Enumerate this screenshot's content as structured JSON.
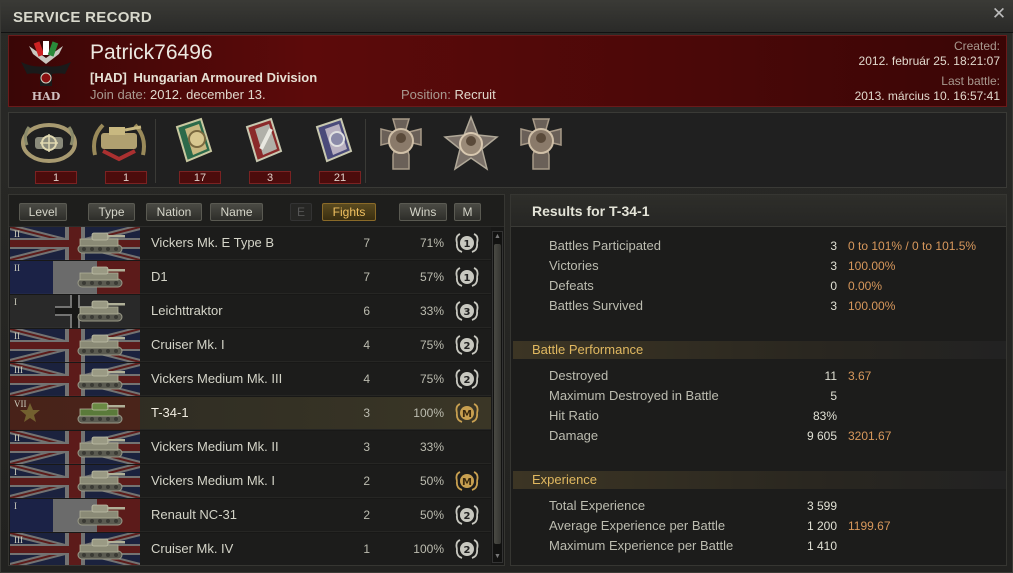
{
  "window": {
    "title": "SERVICE RECORD",
    "close_symbol": "✕"
  },
  "player": {
    "name": "Patrick76496",
    "clan_tag": "[HAD]",
    "clan_name": "Hungarian Armoured Division",
    "join_label": "Join date:",
    "join_date": "2012. december 13.",
    "position_label": "Position:",
    "position": "Recruit",
    "created_label": "Created:",
    "created": "2012. február 25. 18:21:07",
    "last_battle_label": "Last battle:",
    "last_battle": "2013. március 10. 16:57:41"
  },
  "medals": [
    {
      "icon": "sniper-tank-badge-icon",
      "count": "1"
    },
    {
      "icon": "tank-expert-badge-icon",
      "count": "1"
    },
    {
      "icon": "green-ribbon-medal-icon",
      "count": "17"
    },
    {
      "icon": "red-ribbon-medal-icon",
      "count": "3"
    },
    {
      "icon": "blue-ribbon-medal-icon",
      "count": "21"
    },
    {
      "icon": "cross-medal-1-icon",
      "count": ""
    },
    {
      "icon": "star-medal-icon",
      "count": ""
    },
    {
      "icon": "cross-medal-2-icon",
      "count": ""
    }
  ],
  "sort_buttons": {
    "level": "Level",
    "type": "Type",
    "nation": "Nation",
    "name": "Name",
    "e": "E",
    "fights": "Fights",
    "wins": "Wins",
    "m": "M"
  },
  "tanks": [
    {
      "tier": "II",
      "nation": "uk",
      "name": "Vickers Mk. E Type B",
      "fights": "7",
      "wins": "71%",
      "mastery": "1",
      "selected": false
    },
    {
      "tier": "II",
      "nation": "france",
      "name": "D1",
      "fights": "7",
      "wins": "57%",
      "mastery": "1",
      "selected": false
    },
    {
      "tier": "I",
      "nation": "germany",
      "name": "Leichttraktor",
      "fights": "6",
      "wins": "33%",
      "mastery": "3",
      "selected": false
    },
    {
      "tier": "II",
      "nation": "uk",
      "name": "Cruiser Mk. I",
      "fights": "4",
      "wins": "75%",
      "mastery": "2",
      "selected": false
    },
    {
      "tier": "III",
      "nation": "uk",
      "name": "Vickers Medium Mk. III",
      "fights": "4",
      "wins": "75%",
      "mastery": "2",
      "selected": false
    },
    {
      "tier": "VII",
      "nation": "ussr",
      "name": "T-34-1",
      "fights": "3",
      "wins": "100%",
      "mastery": "M",
      "selected": true
    },
    {
      "tier": "II",
      "nation": "uk",
      "name": "Vickers Medium Mk. II",
      "fights": "3",
      "wins": "33%",
      "mastery": "",
      "selected": false
    },
    {
      "tier": "I",
      "nation": "uk",
      "name": "Vickers Medium Mk. I",
      "fights": "2",
      "wins": "50%",
      "mastery": "M",
      "selected": false
    },
    {
      "tier": "I",
      "nation": "france",
      "name": "Renault NC-31",
      "fights": "2",
      "wins": "50%",
      "mastery": "2",
      "selected": false
    },
    {
      "tier": "III",
      "nation": "uk",
      "name": "Cruiser Mk. IV",
      "fights": "1",
      "wins": "100%",
      "mastery": "2",
      "selected": false
    }
  ],
  "results": {
    "title": "Results for T-34-1",
    "general": [
      {
        "label": "Battles Participated",
        "value": "3",
        "extra": "0 to 101% / 0 to 101.5%"
      },
      {
        "label": "Victories",
        "value": "3",
        "extra": "100.00%"
      },
      {
        "label": "Defeats",
        "value": "0",
        "extra": "0.00%"
      },
      {
        "label": "Battles Survived",
        "value": "3",
        "extra": "100.00%"
      }
    ],
    "performance_title": "Battle Performance",
    "performance": [
      {
        "label": "Destroyed",
        "value": "11",
        "extra": "3.67"
      },
      {
        "label": "Maximum Destroyed in Battle",
        "value": "5",
        "extra": ""
      },
      {
        "label": "Hit Ratio",
        "value": "83%",
        "extra": ""
      },
      {
        "label": "Damage",
        "value": "9 605",
        "extra": "3201.67"
      }
    ],
    "experience_title": "Experience",
    "experience": [
      {
        "label": "Total Experience",
        "value": "3 599",
        "extra": ""
      },
      {
        "label": "Average Experience per Battle",
        "value": "1 200",
        "extra": "1199.67"
      },
      {
        "label": "Maximum Experience per Battle",
        "value": "1 410",
        "extra": ""
      }
    ]
  },
  "colors": {
    "header_red": "#5c0a0a",
    "accent_gold": "#e0b860",
    "extra_orange": "#d8985c"
  }
}
